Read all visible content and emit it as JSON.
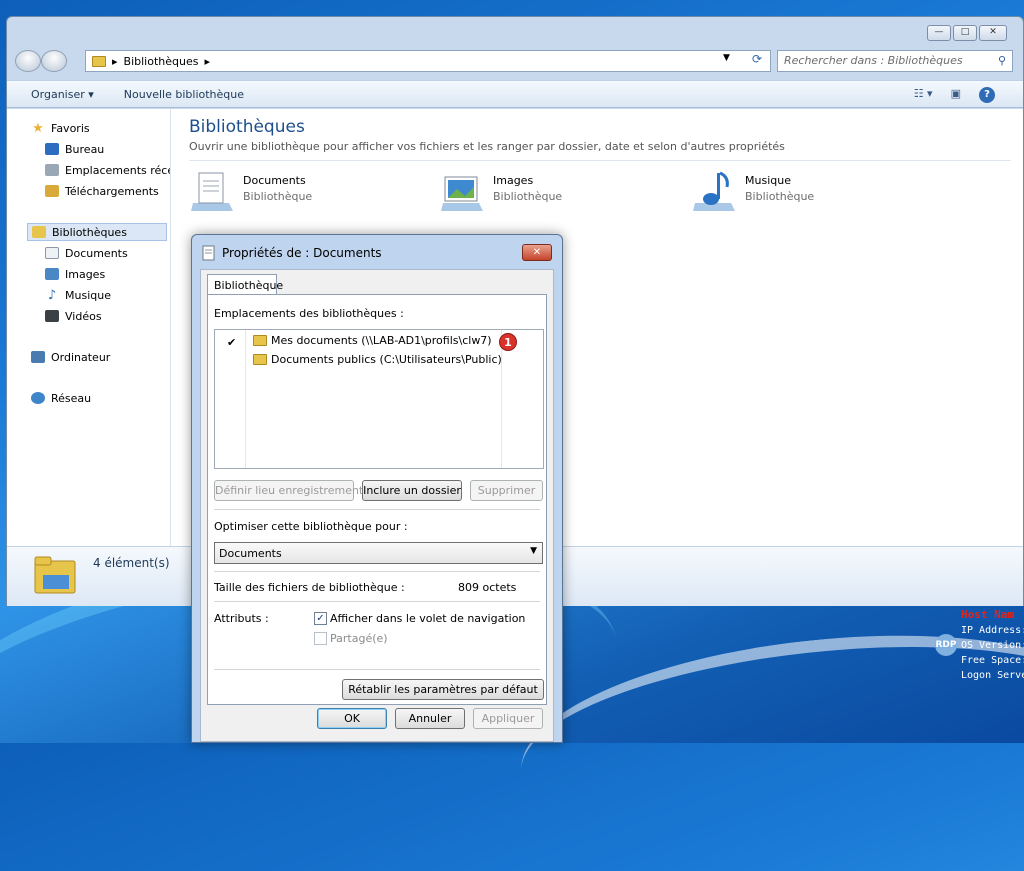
{
  "explorer": {
    "window_buttons": [
      "—",
      "□",
      "✕"
    ],
    "breadcrumb": [
      "Bibliothèques"
    ],
    "search_placeholder": "Rechercher dans : Bibliothèques",
    "toolbar": {
      "organize": "Organiser ▾",
      "new_library": "Nouvelle bibliothèque"
    },
    "sidebar": {
      "favorites": "Favoris",
      "favorites_items": [
        "Bureau",
        "Emplacements récents",
        "Téléchargements"
      ],
      "libraries": "Bibliothèques",
      "libraries_items": [
        "Documents",
        "Images",
        "Musique",
        "Vidéos"
      ],
      "computer": "Ordinateur",
      "network": "Réseau"
    },
    "main": {
      "title": "Bibliothèques",
      "description": "Ouvrir une bibliothèque pour afficher vos fichiers et les ranger par dossier, date et selon d'autres propriétés",
      "libraries": [
        {
          "name": "Documents",
          "type": "Bibliothèque"
        },
        {
          "name": "Images",
          "type": "Bibliothèque"
        },
        {
          "name": "Musique",
          "type": "Bibliothèque"
        }
      ]
    },
    "status": "4 élément(s)"
  },
  "dialog": {
    "title": "Propriétés de : Documents",
    "tab": "Bibliothèque",
    "locations_label": "Emplacements des bibliothèques :",
    "locations": [
      {
        "path": "Mes documents (\\\\LAB-AD1\\profils\\clw7)",
        "checked": true
      },
      {
        "path": "Documents publics (C:\\Utilisateurs\\Public)",
        "checked": false
      }
    ],
    "badge": "1",
    "buttons": {
      "set_save": "Définir lieu enregistrement",
      "include": "Inclure un dossier",
      "remove": "Supprimer"
    },
    "optimize_label": "Optimiser cette bibliothèque pour :",
    "optimize_value": "Documents",
    "size_label": "Taille des fichiers de bibliothèque :",
    "size_value": "809 octets",
    "attributes_label": "Attributs :",
    "attr_nav": "Afficher dans le volet de navigation",
    "attr_shared": "Partagé(e)",
    "restore": "Rétablir les paramètres par défaut",
    "ok": "OK",
    "cancel": "Annuler",
    "apply": "Appliquer"
  },
  "overlay": {
    "title": "Host Nam",
    "lines": [
      "IP Address:",
      "OS Version:",
      "Free Space:",
      "Logon Serve"
    ],
    "logo": "RDP"
  }
}
